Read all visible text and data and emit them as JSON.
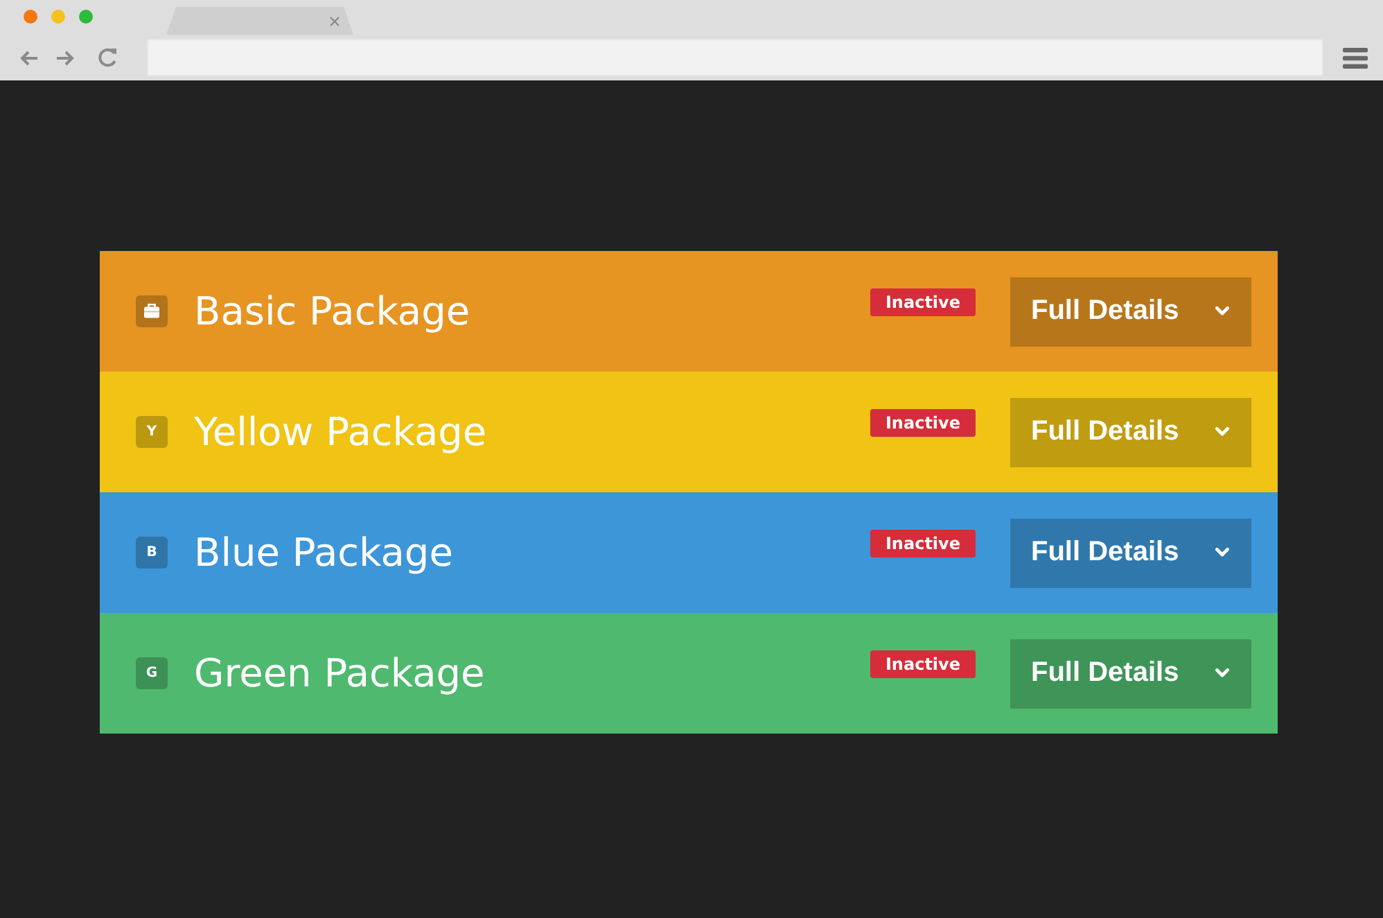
{
  "packages": [
    {
      "kind": "icon",
      "title": "Basic Package",
      "color": "#e69422",
      "status": "Inactive",
      "button": "Full Details"
    },
    {
      "kind": "letter",
      "letter": "Y",
      "title": "Yellow Package",
      "color": "#f0c314",
      "status": "Inactive",
      "button": "Full Details"
    },
    {
      "kind": "letter",
      "letter": "B",
      "title": "Blue Package",
      "color": "#3d96d8",
      "status": "Inactive",
      "button": "Full Details"
    },
    {
      "kind": "letter",
      "letter": "G",
      "title": "Green Package",
      "color": "#4fb96f",
      "status": "Inactive",
      "button": "Full Details"
    }
  ]
}
